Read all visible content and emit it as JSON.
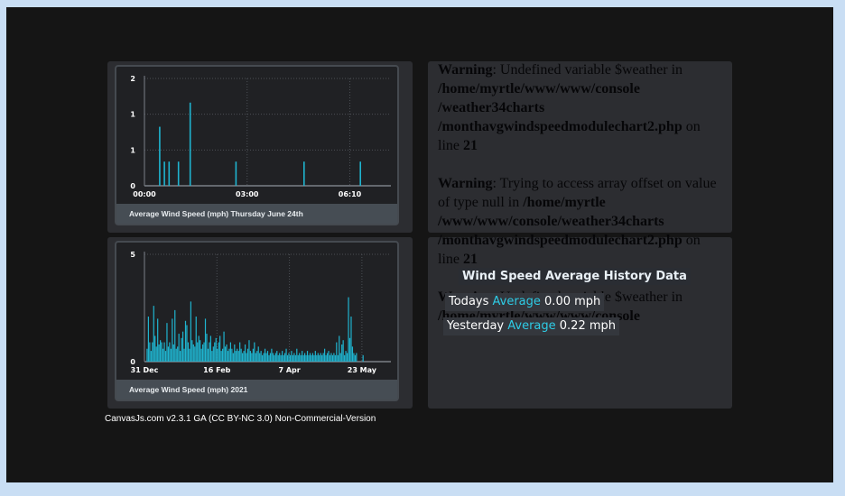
{
  "colors": {
    "accent": "#2ecce6",
    "bar": "#1fb4cf",
    "frame_bg": "#151515",
    "panel_bg": "#2c2d31",
    "chart_bg": "#202124",
    "caption_bg": "#464d54"
  },
  "php_output": [
    {
      "label": "Warning",
      "text": ": Undefined variable $weather in ",
      "path": "/home/myrtle/www/www/console /weather34charts /monthavgwindspeedmodulechart2.php",
      "suffix": " on line ",
      "line": "21"
    },
    {
      "label": "Warning",
      "text": ": Trying to access array offset on value of type null in ",
      "path": "/home/myrtle /www/www/console/weather34charts /monthavgwindspeedmodulechart2.php",
      "suffix": " on line ",
      "line": "21"
    },
    {
      "label": "Warning",
      "text": ": Undefined variable $weather in ",
      "path": "/home/myrtle/www/www/console",
      "suffix": "",
      "line": ""
    }
  ],
  "history": {
    "title": "Wind Speed Average History Data",
    "today_prefix": "Todays ",
    "today_accent": "Average",
    "today_value": " 0.00 mph",
    "yesterday_prefix": "Yesterday ",
    "yesterday_accent": "Average",
    "yesterday_value": " 0.22 mph"
  },
  "credit": "CanvasJs.com v2.3.1 GA (CC BY-NC 3.0) Non-Commercial-Version",
  "chart_data": [
    {
      "type": "bar",
      "caption": "Average Wind Speed (mph) Thursday June 24th",
      "x_ticks": [
        "00:00",
        "03:00",
        "06:10"
      ],
      "x_range": [
        0,
        10.5
      ],
      "y_ticks": [
        "2",
        "1",
        "1",
        "0"
      ],
      "y_range": [
        0,
        2
      ],
      "grid": true,
      "x": [
        0.65,
        0.85,
        1.05,
        1.45,
        1.95,
        3.9,
        6.8,
        9.2
      ],
      "values": [
        1.1,
        0.45,
        0.45,
        0.45,
        1.55,
        0.45,
        0.45,
        0.45
      ]
    },
    {
      "type": "bar",
      "caption": "Average Wind Speed (mph) 2021",
      "x_ticks": [
        "31 Dec",
        "16 Feb",
        "7 Apr",
        "23 May"
      ],
      "x_range": [
        0,
        186
      ],
      "y_ticks": [
        "5",
        "0"
      ],
      "y_range": [
        0,
        5
      ],
      "grid": true,
      "x": [
        2,
        3,
        4,
        5,
        6,
        7,
        8,
        9,
        10,
        11,
        12,
        13,
        14,
        15,
        16,
        17,
        18,
        19,
        20,
        21,
        22,
        23,
        24,
        25,
        26,
        27,
        28,
        29,
        30,
        31,
        32,
        33,
        34,
        35,
        36,
        37,
        38,
        39,
        40,
        41,
        42,
        43,
        44,
        45,
        46,
        47,
        48,
        49,
        50,
        51,
        52,
        53,
        54,
        55,
        56,
        57,
        58,
        59,
        60,
        61,
        62,
        63,
        64,
        65,
        66,
        67,
        68,
        69,
        70,
        71,
        72,
        73,
        74,
        75,
        76,
        77,
        78,
        79,
        80,
        81,
        82,
        83,
        84,
        85,
        86,
        87,
        88,
        89,
        90,
        91,
        92,
        93,
        94,
        95,
        96,
        97,
        98,
        99,
        100,
        101,
        102,
        103,
        104,
        105,
        106,
        107,
        108,
        109,
        110,
        111,
        112,
        113,
        114,
        115,
        116,
        117,
        118,
        119,
        120,
        121,
        122,
        123,
        124,
        125,
        126,
        127,
        128,
        129,
        130,
        131,
        132,
        133,
        134,
        135,
        136,
        137,
        138,
        139,
        140,
        141,
        142,
        143,
        144,
        145,
        146,
        147,
        148,
        149,
        150,
        151,
        152,
        153,
        154,
        155,
        156,
        157,
        158,
        159,
        160,
        165,
        170,
        184
      ],
      "values": [
        0.6,
        2.1,
        0.9,
        0.5,
        0.9,
        2.6,
        1.2,
        0.7,
        2.0,
        0.8,
        1.0,
        0.9,
        0.6,
        0.9,
        0.5,
        1.8,
        0.7,
        0.9,
        0.6,
        2.0,
        0.8,
        2.4,
        0.6,
        0.7,
        1.3,
        0.5,
        1.1,
        1.4,
        0.6,
        1.9,
        1.7,
        0.9,
        0.6,
        2.8,
        1.0,
        0.8,
        0.7,
        2.1,
        0.9,
        1.2,
        1.0,
        0.6,
        0.8,
        0.9,
        2.0,
        1.3,
        0.6,
        0.9,
        1.2,
        0.5,
        0.7,
        0.9,
        1.1,
        0.6,
        0.9,
        1.2,
        0.5,
        0.6,
        1.4,
        0.7,
        0.8,
        0.5,
        0.6,
        0.9,
        0.6,
        0.4,
        0.8,
        0.5,
        0.6,
        0.5,
        0.9,
        0.6,
        0.4,
        0.5,
        0.8,
        0.4,
        0.6,
        1.0,
        0.5,
        0.4,
        0.6,
        0.9,
        0.4,
        0.5,
        0.7,
        0.4,
        0.5,
        0.3,
        0.4,
        0.6,
        0.4,
        0.5,
        0.3,
        0.4,
        0.6,
        0.4,
        0.3,
        0.4,
        0.5,
        0.3,
        0.4,
        0.3,
        0.5,
        0.3,
        0.4,
        0.6,
        0.3,
        0.4,
        0.3,
        0.5,
        0.3,
        0.4,
        0.3,
        0.6,
        0.3,
        0.4,
        0.3,
        0.5,
        0.3,
        0.4,
        0.3,
        0.5,
        0.3,
        0.4,
        0.3,
        0.4,
        0.3,
        0.5,
        0.3,
        0.4,
        0.3,
        0.4,
        0.3,
        0.4,
        0.6,
        0.3,
        0.4,
        0.5,
        0.3,
        0.4,
        0.3,
        0.4,
        0.3,
        0.9,
        0.3,
        1.2,
        0.4,
        0.8,
        1.0,
        0.3,
        0.5,
        0.4,
        3.0,
        1.1,
        2.1,
        0.7,
        0.4,
        0.3,
        0.4,
        0.3
      ]
    }
  ]
}
